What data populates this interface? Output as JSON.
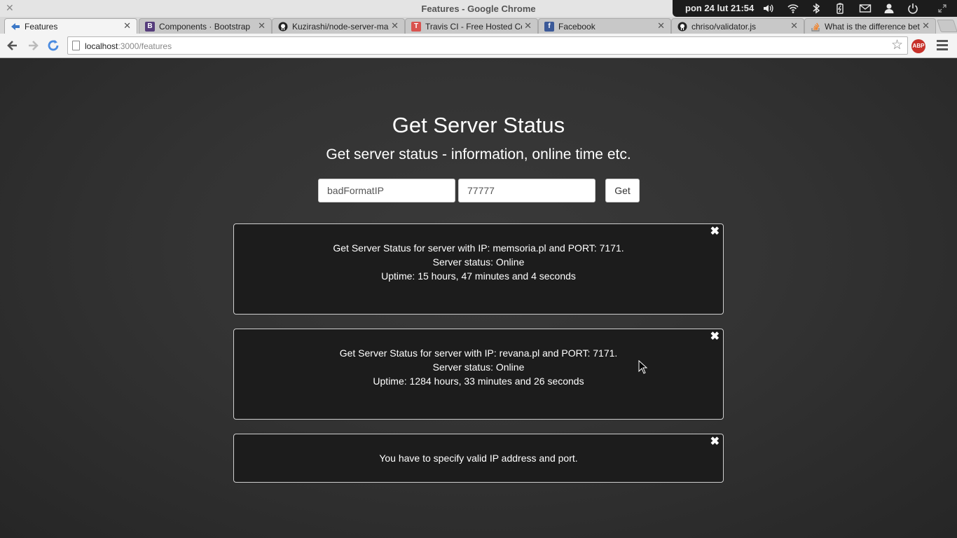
{
  "window": {
    "title": "Features - Google Chrome",
    "clock": "pon 24 lut 21:54"
  },
  "tabs": [
    {
      "label": "Features",
      "icon": "chrome-icon",
      "active": true
    },
    {
      "label": "Components · Bootstrap",
      "icon": "bootstrap-icon"
    },
    {
      "label": "Kuzirashi/node-server-ma",
      "icon": "github-icon"
    },
    {
      "label": "Travis CI - Free Hosted Co",
      "icon": "travis-icon"
    },
    {
      "label": "Facebook",
      "icon": "facebook-icon"
    },
    {
      "label": "chriso/validator.js",
      "icon": "github-icon"
    },
    {
      "label": "What is the difference bet",
      "icon": "stackoverflow-icon"
    }
  ],
  "toolbar": {
    "url_host": "localhost",
    "url_path": ":3000/features",
    "abp_label": "ABP"
  },
  "page": {
    "title": "Get Server Status",
    "subtitle": "Get server status - information, online time etc.",
    "ip_value": "badFormatIP",
    "port_value": "77777",
    "get_label": "Get"
  },
  "results": [
    {
      "lines": [
        "Get Server Status for server with IP: memsoria.pl and PORT: 7171.",
        "Server status: Online",
        "Uptime: 15 hours, 47 minutes and 4 seconds"
      ]
    },
    {
      "lines": [
        "Get Server Status for server with IP: revana.pl and PORT: 7171.",
        "Server status: Online",
        "Uptime: 1284 hours, 33 minutes and 26 seconds"
      ]
    },
    {
      "lines": [
        "You have to specify valid IP address and port."
      ]
    }
  ],
  "icons": {
    "close": "✕",
    "card_close": "✖"
  }
}
